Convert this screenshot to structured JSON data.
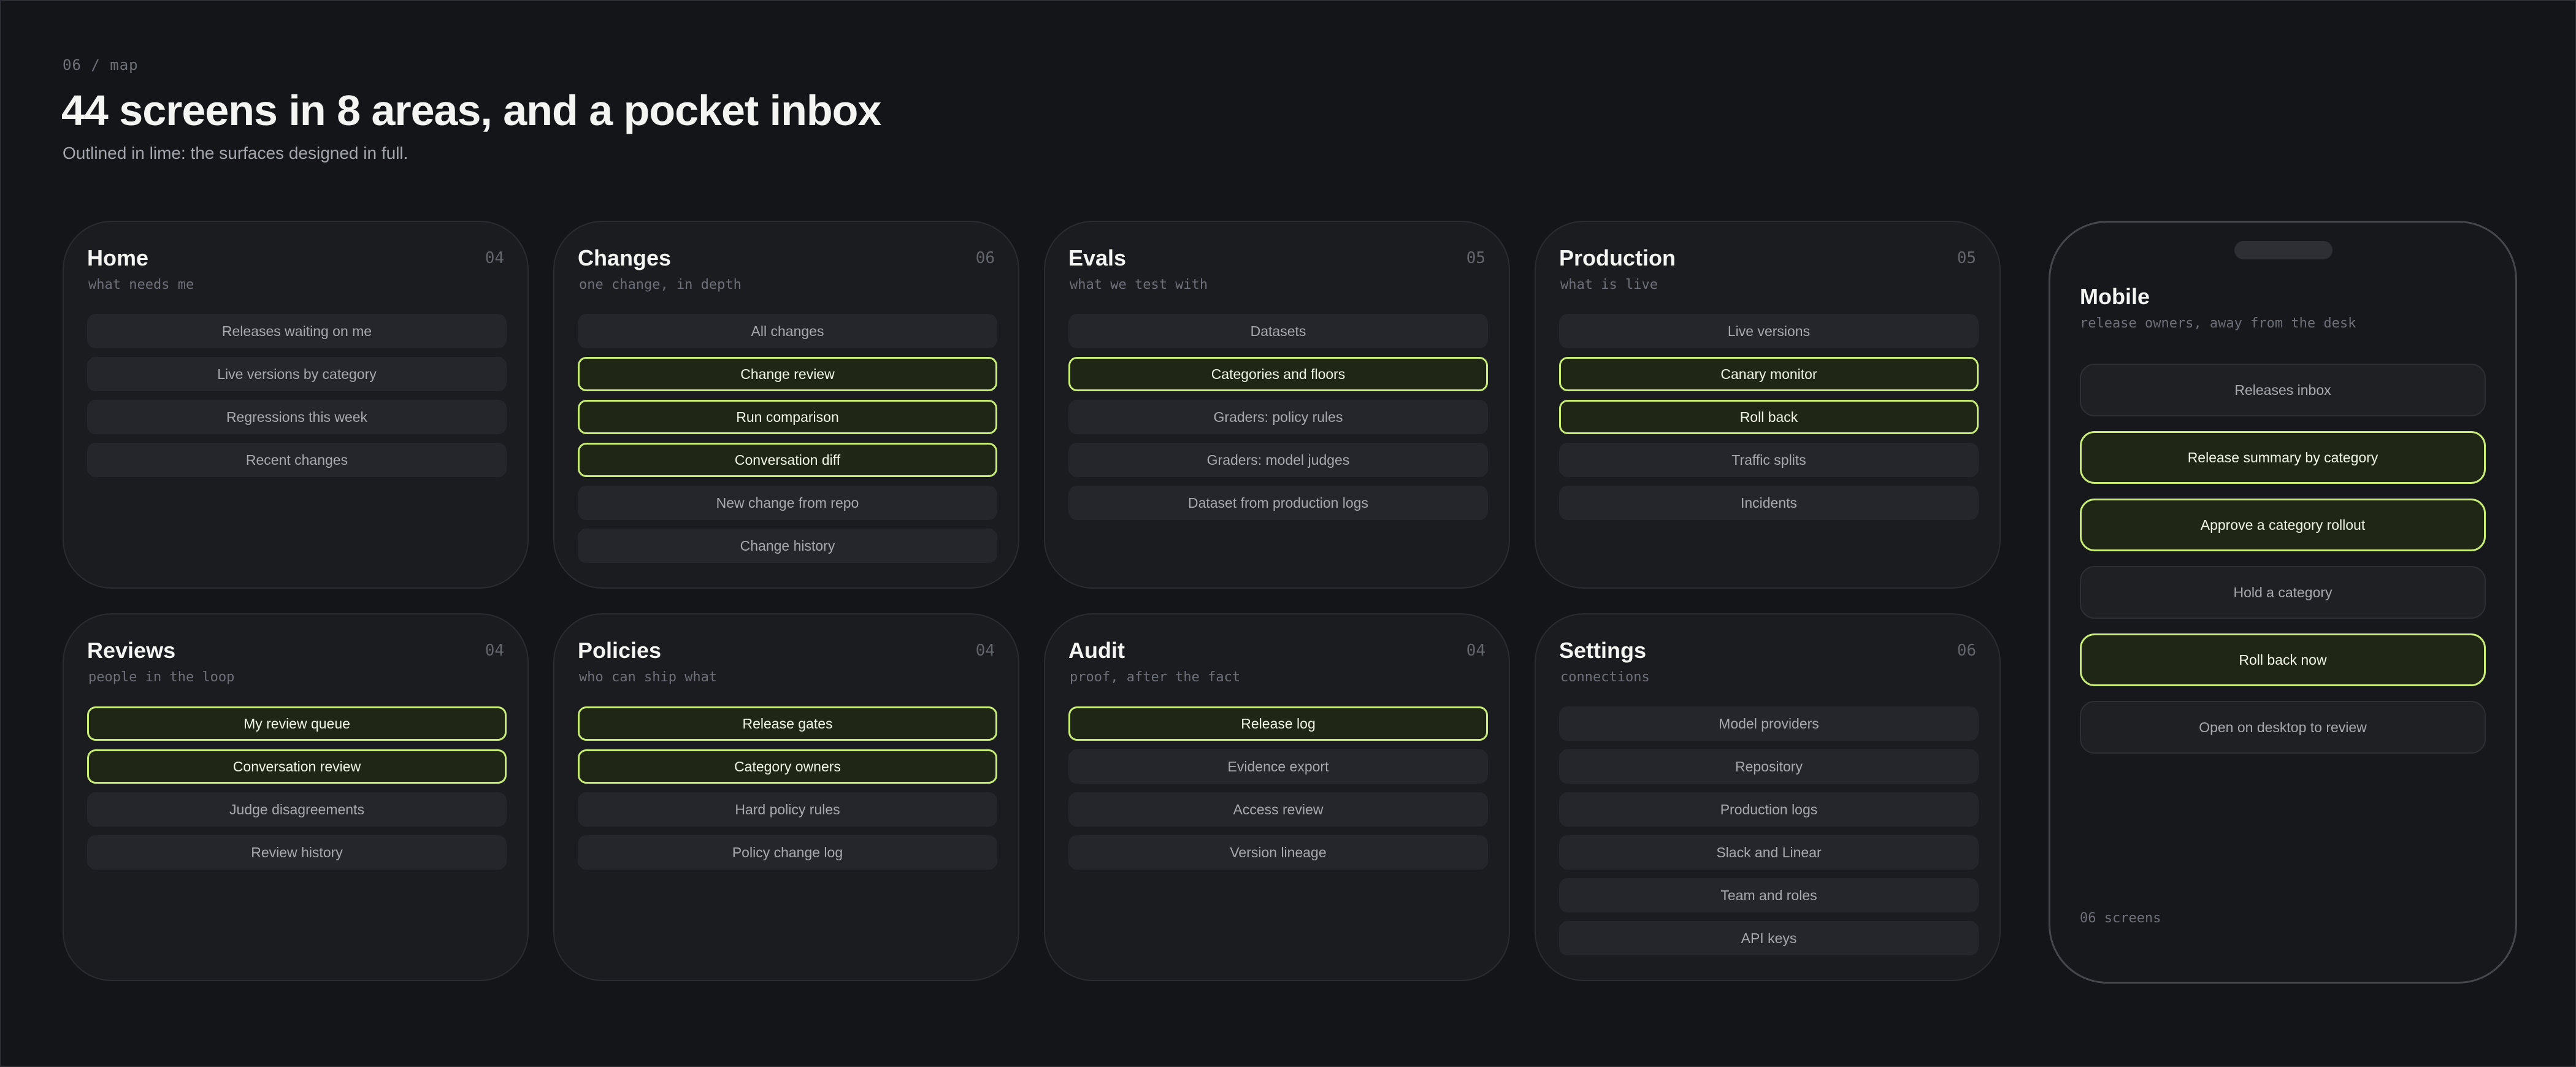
{
  "header": {
    "eyebrow": "06 / map",
    "title": "44 screens in 8 areas, and a pocket inbox",
    "subtitle": "Outlined in lime: the surfaces designed in full."
  },
  "colors": {
    "background": "#141518",
    "card": "#1b1c20",
    "pill": "#24262b",
    "accent_lime": "#c8ec77",
    "accent_fill": "#1f2616"
  },
  "areas": [
    {
      "name": "Home",
      "count": "04",
      "desc": "what needs me",
      "screens": [
        {
          "label": "Releases waiting on me",
          "full": false
        },
        {
          "label": "Live versions by category",
          "full": false
        },
        {
          "label": "Regressions this week",
          "full": false
        },
        {
          "label": "Recent changes",
          "full": false
        }
      ]
    },
    {
      "name": "Changes",
      "count": "06",
      "desc": "one change, in depth",
      "screens": [
        {
          "label": "All changes",
          "full": false
        },
        {
          "label": "Change review",
          "full": true
        },
        {
          "label": "Run comparison",
          "full": true
        },
        {
          "label": "Conversation diff",
          "full": true
        },
        {
          "label": "New change from repo",
          "full": false
        },
        {
          "label": "Change history",
          "full": false
        }
      ]
    },
    {
      "name": "Evals",
      "count": "05",
      "desc": "what we test with",
      "screens": [
        {
          "label": "Datasets",
          "full": false
        },
        {
          "label": "Categories and floors",
          "full": true
        },
        {
          "label": "Graders: policy rules",
          "full": false
        },
        {
          "label": "Graders: model judges",
          "full": false
        },
        {
          "label": "Dataset from production logs",
          "full": false
        }
      ]
    },
    {
      "name": "Production",
      "count": "05",
      "desc": "what is live",
      "screens": [
        {
          "label": "Live versions",
          "full": false
        },
        {
          "label": "Canary monitor",
          "full": true
        },
        {
          "label": "Roll back",
          "full": true
        },
        {
          "label": "Traffic splits",
          "full": false
        },
        {
          "label": "Incidents",
          "full": false
        }
      ]
    },
    {
      "name": "Reviews",
      "count": "04",
      "desc": "people in the loop",
      "screens": [
        {
          "label": "My review queue",
          "full": true
        },
        {
          "label": "Conversation review",
          "full": true
        },
        {
          "label": "Judge disagreements",
          "full": false
        },
        {
          "label": "Review history",
          "full": false
        }
      ]
    },
    {
      "name": "Policies",
      "count": "04",
      "desc": "who can ship what",
      "screens": [
        {
          "label": "Release gates",
          "full": true
        },
        {
          "label": "Category owners",
          "full": true
        },
        {
          "label": "Hard policy rules",
          "full": false
        },
        {
          "label": "Policy change log",
          "full": false
        }
      ]
    },
    {
      "name": "Audit",
      "count": "04",
      "desc": "proof, after the fact",
      "screens": [
        {
          "label": "Release log",
          "full": true
        },
        {
          "label": "Evidence export",
          "full": false
        },
        {
          "label": "Access review",
          "full": false
        },
        {
          "label": "Version lineage",
          "full": false
        }
      ]
    },
    {
      "name": "Settings",
      "count": "06",
      "desc": "connections",
      "screens": [
        {
          "label": "Model providers",
          "full": false
        },
        {
          "label": "Repository",
          "full": false
        },
        {
          "label": "Production logs",
          "full": false
        },
        {
          "label": "Slack and Linear",
          "full": false
        },
        {
          "label": "Team and roles",
          "full": false
        },
        {
          "label": "API keys",
          "full": false
        }
      ]
    }
  ],
  "mobile": {
    "name": "Mobile",
    "desc": "release owners, away from the desk",
    "footer": "06 screens",
    "screens": [
      {
        "label": "Releases inbox",
        "full": false
      },
      {
        "label": "Release summary by category",
        "full": true
      },
      {
        "label": "Approve a category rollout",
        "full": true
      },
      {
        "label": "Hold a category",
        "full": false
      },
      {
        "label": "Roll back now",
        "full": true
      },
      {
        "label": "Open on desktop to review",
        "full": false
      }
    ]
  }
}
